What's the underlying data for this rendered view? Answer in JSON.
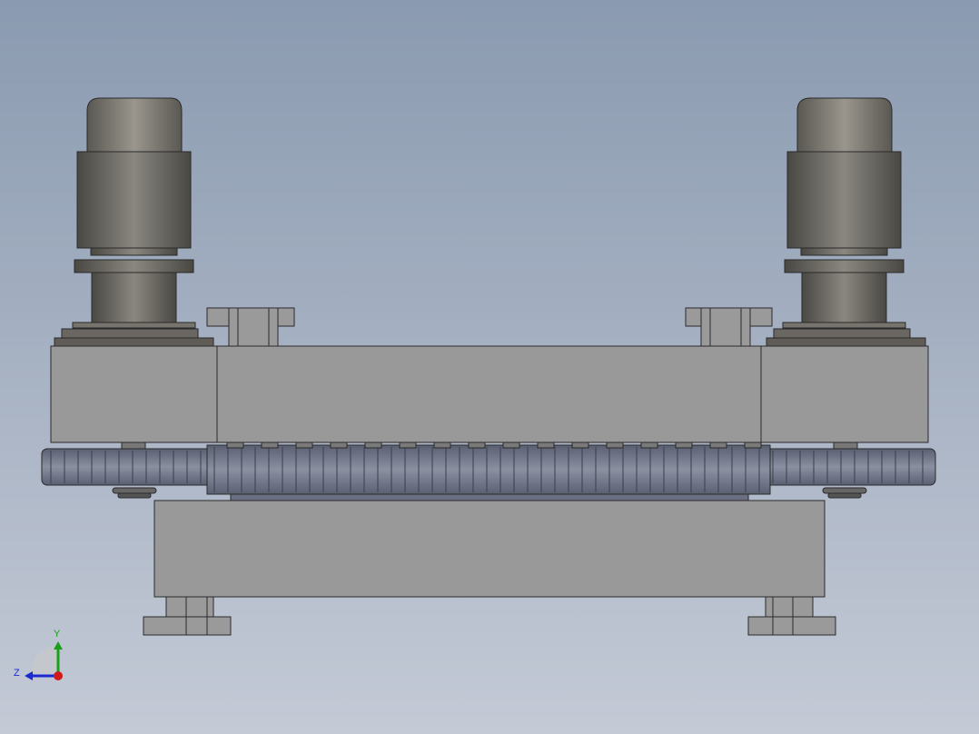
{
  "viewport": {
    "background_top": "#8a9ab0",
    "background_bottom": "#c4cad6"
  },
  "colors": {
    "motor_dark": "#56534d",
    "motor_light": "#8a8780",
    "plate": "#999999",
    "plate_edge": "#2a2a2a",
    "gear": "#7a8190",
    "gear_dark": "#50566a",
    "bracket": "#9a9a9a"
  },
  "triad": {
    "y_label": "Y",
    "z_label": "Z",
    "y_color": "#1aa01a",
    "z_color": "#1a2ad0",
    "origin_color": "#d01818"
  }
}
